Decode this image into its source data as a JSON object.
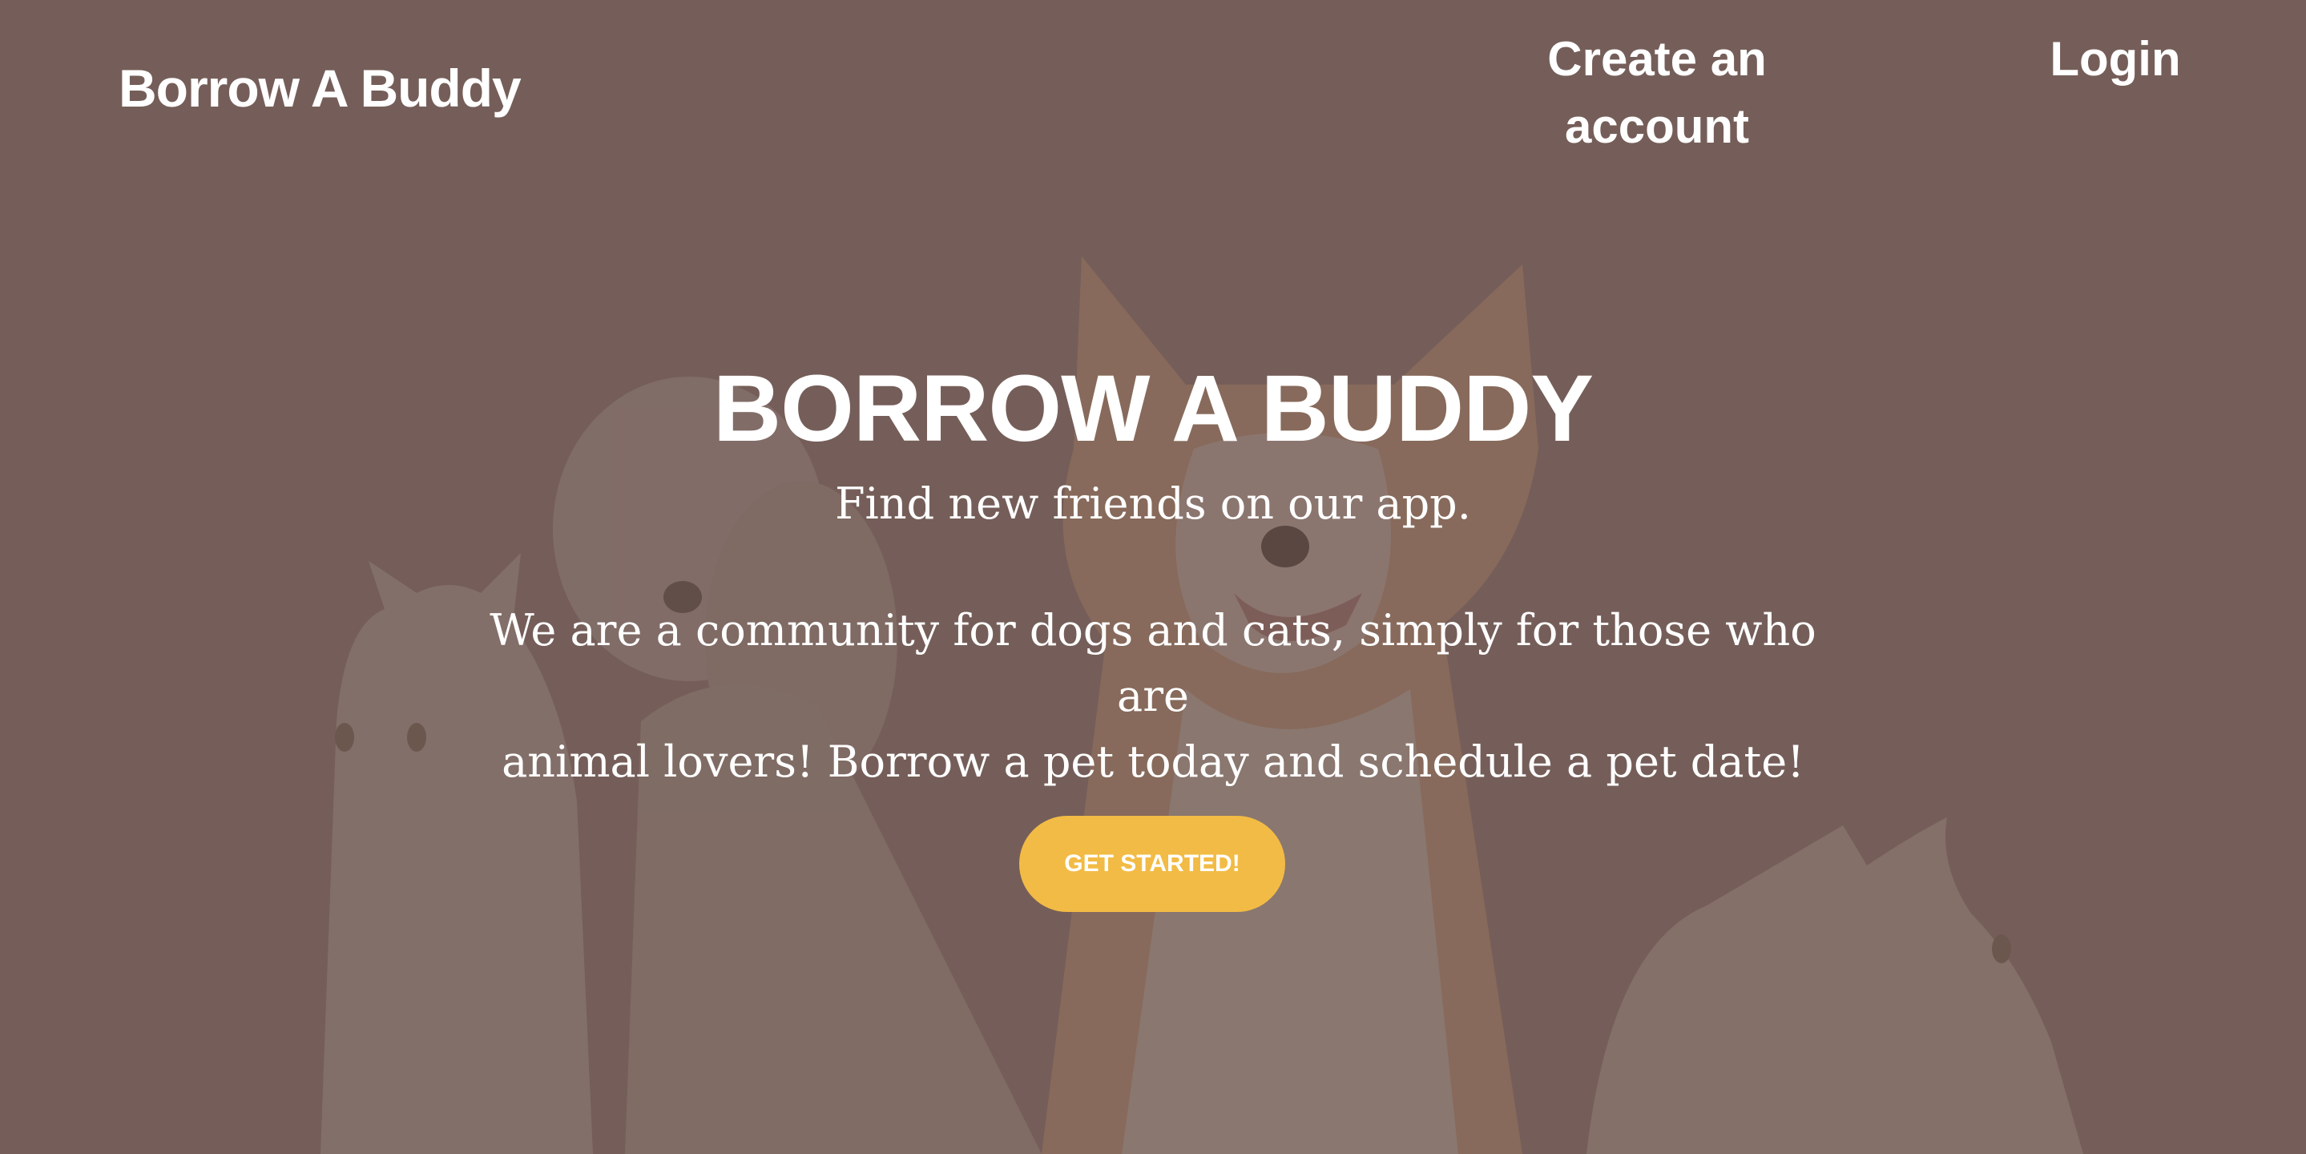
{
  "nav": {
    "logo": "Borrow A Buddy",
    "create_account_line1": "Create an",
    "create_account_line2": "account",
    "login": "Login"
  },
  "hero": {
    "title": "BORROW A BUDDY",
    "subtitle": "Find new friends on our app.",
    "description_line1": "We are a community for dogs and cats, simply for those who are",
    "description_line2": "animal lovers! Borrow a pet today and schedule a pet date!",
    "cta_label": "GET STARTED!"
  },
  "colors": {
    "overlay": "#765f5a",
    "accent": "#f2bb45",
    "text": "#ffffff"
  }
}
